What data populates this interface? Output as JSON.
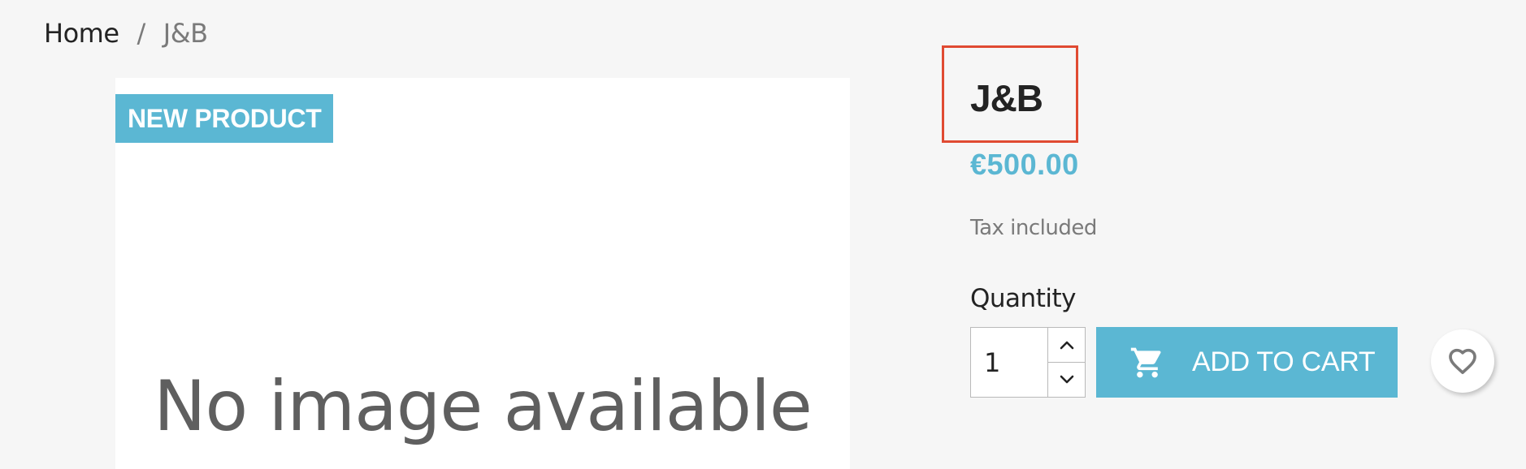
{
  "breadcrumb": {
    "home": "Home",
    "separator": "/",
    "current": "J&B"
  },
  "image_panel": {
    "badge": "NEW PRODUCT",
    "placeholder_text": "No image available"
  },
  "product": {
    "name": "J&B",
    "price": "€500.00",
    "tax_note": "Tax included",
    "quantity_label": "Quantity",
    "quantity_value": "1"
  },
  "actions": {
    "add_to_cart": "ADD TO CART",
    "cart_icon": "shopping-cart-icon",
    "wishlist_icon": "heart-outline-icon",
    "increment_icon": "chevron-up-icon",
    "decrement_icon": "chevron-down-icon"
  },
  "colors": {
    "accent": "#5bb7d3",
    "highlight_box": "#e04a32",
    "background": "#f6f6f6"
  }
}
